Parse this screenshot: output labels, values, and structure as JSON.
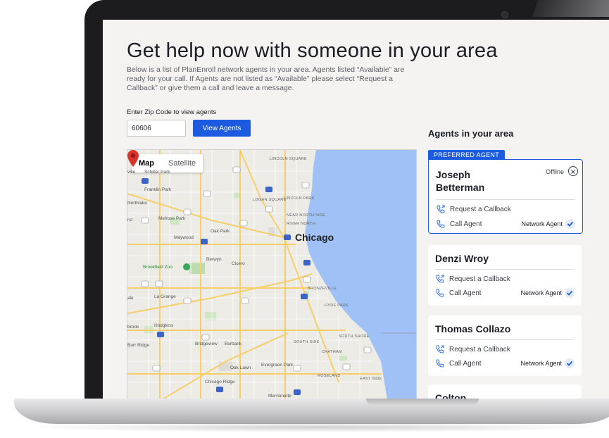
{
  "page": {
    "title": "Get help now with someone in your area",
    "intro": "Below is a list of PlanEnroll network agents in your area. Agents listed “Available” are ready for your call. If Agents are not listed as “Available” please select “Request a Callback” or give them a call and leave a message.",
    "zip_label": "Enter Zip Code to view agents",
    "zip_value": "60606",
    "view_agents_label": "View Agents"
  },
  "map": {
    "tabs": [
      "Map",
      "Satellite"
    ],
    "active_tab": "Map",
    "labels": {
      "chicago": "Chicago",
      "franklin_park": "Franklin Park",
      "northlake": "Northlake",
      "melrose_park": "Melrose Park",
      "maywood": "Maywood",
      "oak_park": "Oak Park",
      "berwyn": "Berwyn",
      "cicero": "Cicero",
      "brookfield_zoo": "Brookfield Zoo",
      "la_grange": "La Grange",
      "hodgkins": "Hodgkins",
      "bridgeview": "Bridgeview",
      "burbank": "Burbank",
      "oak_lawn": "Oak Lawn",
      "evergreen_park": "Evergreen Park",
      "chicago_ridge": "Chicago Ridge",
      "merrionette_park": "Merrionette",
      "burr_ridge": "Burr Ridge",
      "brook": "brook",
      "ale": "ale",
      "rst": "rst",
      "ville": "ville",
      "schiller_park": "Schiller Park",
      "lincoln_square": "LINCOLN SQUARE",
      "logan_square": "LOGAN SQUARE",
      "lincoln_park": "LINCOLN PARK",
      "near_north_side": "NEAR NORTH SIDE",
      "river_north": "RIVER NORTH",
      "bronzeville": "BRONZEVILLE",
      "hyde_park": "HYDE PARK",
      "south_side": "SOUTH SIDE",
      "chatham": "CHATHAM",
      "south_shore": "SOUTH SHORE",
      "roseland": "ROSELAND",
      "east_side": "EAST SIDE"
    }
  },
  "agents": {
    "heading": "Agents in your area",
    "preferred_badge": "PREFERRED AGENT",
    "request_label": "Request a Callback",
    "call_label": "Call Agent",
    "network_label": "Network Agent",
    "list": [
      {
        "name_line1": "Joseph",
        "name_line2": "Betterman",
        "status": "Offline"
      },
      {
        "name": "Denzi Wroy"
      },
      {
        "name": "Thomas Collazo"
      },
      {
        "name": "Colton"
      }
    ]
  },
  "colors": {
    "accent": "#1c5be0",
    "water": "#9fc1f5",
    "pin": "#d9342b"
  }
}
